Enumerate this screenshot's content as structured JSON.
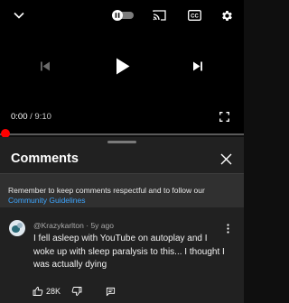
{
  "player": {
    "current_time": "0:00",
    "separator": " / ",
    "duration": "9:10",
    "progress_fraction": 0.0,
    "autoplay_on": false,
    "icons": [
      "chevron-down-icon",
      "autoplay-toggle-icon",
      "cast-icon",
      "closed-captions-icon",
      "settings-gear-icon",
      "previous-icon",
      "play-icon",
      "next-icon",
      "fullscreen-icon"
    ]
  },
  "comments_panel": {
    "title": "Comments",
    "notice_text": "Remember to keep comments respectful and to follow our ",
    "notice_link": "Community Guidelines",
    "icons": [
      "close-icon"
    ]
  },
  "comment": {
    "author": "@Krazykarlton",
    "separator": " · ",
    "age": "5y ago",
    "text": "I fell asleep with YouTube on autoplay and I woke up with sleep paralysis to this... I thought I was actually dying",
    "like_count": "28K",
    "icons": [
      "more-vertical-icon",
      "thumbs-up-icon",
      "thumbs-down-icon",
      "reply-icon"
    ]
  },
  "colors": {
    "background": "#0f0f0f",
    "sheet": "#212121",
    "notice_bg": "#303030",
    "progress": "#ff0000",
    "link": "#3ea6ff"
  }
}
